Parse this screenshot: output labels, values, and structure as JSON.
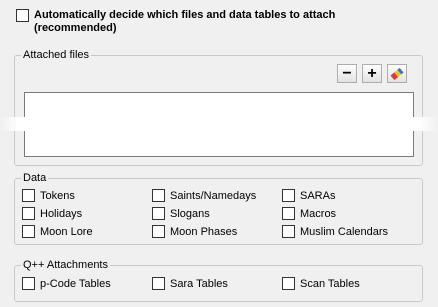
{
  "auto_attach": {
    "line1": "Automatically decide which files and data tables to attach",
    "line2": "(recommended)",
    "checked": false
  },
  "attached_files": {
    "legend": "Attached files",
    "buttons": [
      {
        "name": "remove-button",
        "icon": "minus-icon",
        "glyph": "−"
      },
      {
        "name": "add-button",
        "icon": "plus-icon",
        "glyph": "+"
      },
      {
        "name": "clear-button",
        "icon": "eraser-icon"
      }
    ],
    "items": []
  },
  "data": {
    "legend": "Data",
    "items": [
      {
        "label": "Tokens",
        "checked": false
      },
      {
        "label": "Saints/Namedays",
        "checked": false
      },
      {
        "label": "SARAs",
        "checked": false
      },
      {
        "label": "Holidays",
        "checked": false
      },
      {
        "label": "Slogans",
        "checked": false
      },
      {
        "label": "Macros",
        "checked": false
      },
      {
        "label": "Moon Lore",
        "checked": false
      },
      {
        "label": "Moon Phases",
        "checked": false
      },
      {
        "label": "Muslim Calendars",
        "checked": false
      }
    ]
  },
  "qpp": {
    "legend": "Q++ Attachments",
    "items": [
      {
        "label": "p-Code Tables",
        "checked": false
      },
      {
        "label": "Sara Tables",
        "checked": false
      },
      {
        "label": "Scan Tables",
        "checked": false
      }
    ]
  },
  "colors": {
    "background": "#f0f0f0",
    "eraser_red": "#e0393b",
    "eraser_yellow": "#f1c232",
    "eraser_blue": "#3b6fd1"
  }
}
